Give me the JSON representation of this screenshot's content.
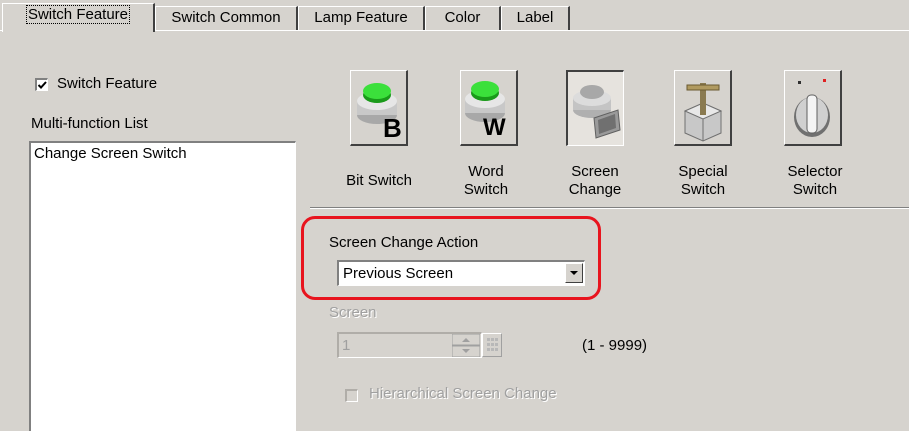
{
  "tabs": [
    {
      "label": "Switch Feature",
      "active": true
    },
    {
      "label": "Switch Common",
      "active": false
    },
    {
      "label": "Lamp Feature",
      "active": false
    },
    {
      "label": "Color",
      "active": false
    },
    {
      "label": "Label",
      "active": false
    }
  ],
  "switch_feature": {
    "label": "Switch Feature",
    "checked": true
  },
  "multifunction": {
    "label": "Multi-function List",
    "items": [
      "Change Screen Switch"
    ]
  },
  "feature_icons": [
    {
      "icon": "bit-switch-icon",
      "line1": "Bit Switch",
      "line2": "",
      "selected": false
    },
    {
      "icon": "word-switch-icon",
      "line1": "Word",
      "line2": "Switch",
      "selected": false
    },
    {
      "icon": "screen-change-icon",
      "line1": "Screen",
      "line2": "Change",
      "selected": true
    },
    {
      "icon": "special-switch-icon",
      "line1": "Special",
      "line2": "Switch",
      "selected": false
    },
    {
      "icon": "selector-switch-icon",
      "line1": "Selector",
      "line2": "Switch",
      "selected": false
    }
  ],
  "screen_change_action": {
    "label": "Screen Change Action",
    "value": "Previous Screen"
  },
  "screen": {
    "label": "Screen",
    "value": "1",
    "range": "(1 - 9999)",
    "enabled": false
  },
  "hierarchical": {
    "label": "Hierarchical Screen Change",
    "checked": false,
    "enabled": false
  },
  "colors": {
    "highlight": "#e8141e",
    "background": "#d6d3ce",
    "green_button": "#2ecc2e"
  }
}
